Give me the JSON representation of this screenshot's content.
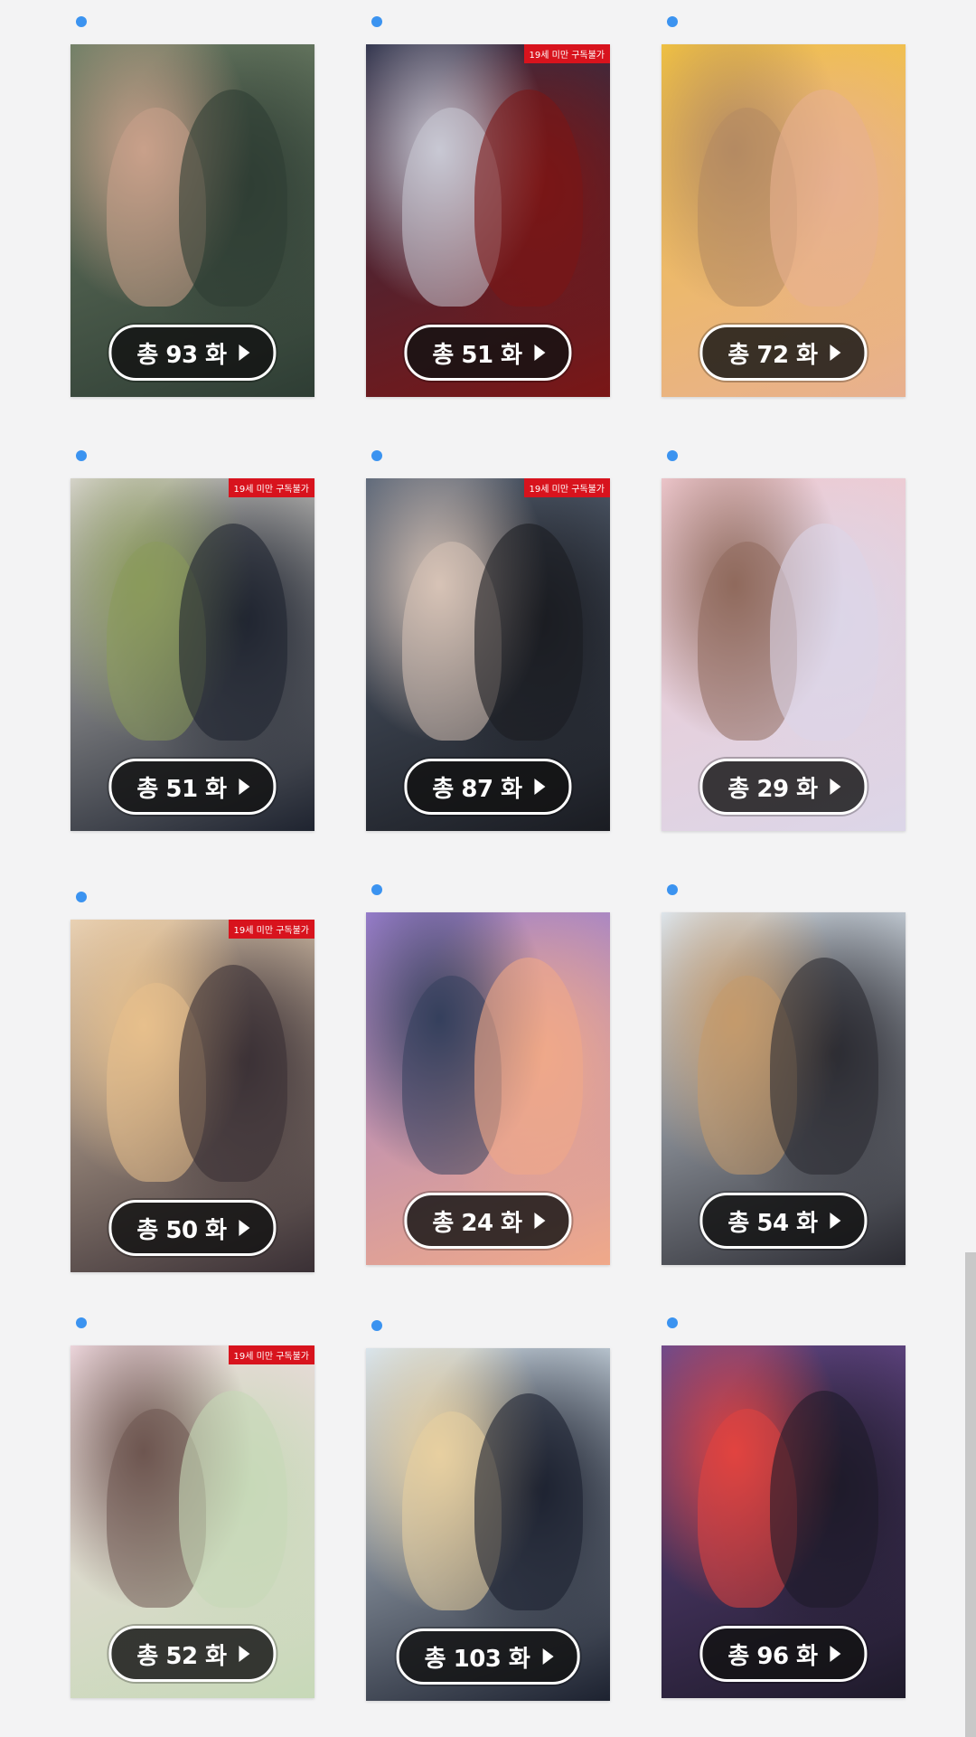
{
  "age_badge_text": "19세 미만 구독불가",
  "dot_color": "#3b93f0",
  "items": [
    {
      "episodes": "총 93 화",
      "adult": false,
      "bg": [
        "#6e7f66",
        "#2e3d34",
        "#c9a08a"
      ]
    },
    {
      "episodes": "총 51 화",
      "adult": true,
      "bg": [
        "#2b2f48",
        "#7a1616",
        "#c8c8d4"
      ]
    },
    {
      "episodes": "총 72 화",
      "adult": false,
      "bg": [
        "#f2c340",
        "#e8b090",
        "#b48a63"
      ]
    },
    {
      "episodes": "총 51 화",
      "adult": true,
      "bg": [
        "#d9d6cf",
        "#1f2430",
        "#8b9a5b"
      ]
    },
    {
      "episodes": "총 87 화",
      "adult": true,
      "bg": [
        "#5a6678",
        "#1a1c22",
        "#d7c3b6"
      ]
    },
    {
      "episodes": "총 29 화",
      "adult": false,
      "bg": [
        "#f0c9cf",
        "#dcd6e8",
        "#8f6a5c"
      ]
    },
    {
      "episodes": "총 50 화",
      "adult": true,
      "bg": [
        "#e9d2b6",
        "#3a3035",
        "#e7c08c"
      ]
    },
    {
      "episodes": "총 24 화",
      "adult": false,
      "bg": [
        "#9a7fd0",
        "#f0a989",
        "#35405c"
      ]
    },
    {
      "episodes": "총 54 화",
      "adult": false,
      "bg": [
        "#dfe9f2",
        "#2b2b32",
        "#c49a6c"
      ]
    },
    {
      "episodes": "총 52 화",
      "adult": true,
      "bg": [
        "#f2dbe2",
        "#c7d9b8",
        "#6e5650"
      ]
    },
    {
      "episodes": "총 103 화",
      "adult": false,
      "bg": [
        "#d9e6f0",
        "#1d2230",
        "#e8d0a0"
      ]
    },
    {
      "episodes": "총 96 화",
      "adult": false,
      "bg": [
        "#6a4b8f",
        "#1e1a2a",
        "#e1443f"
      ]
    }
  ]
}
